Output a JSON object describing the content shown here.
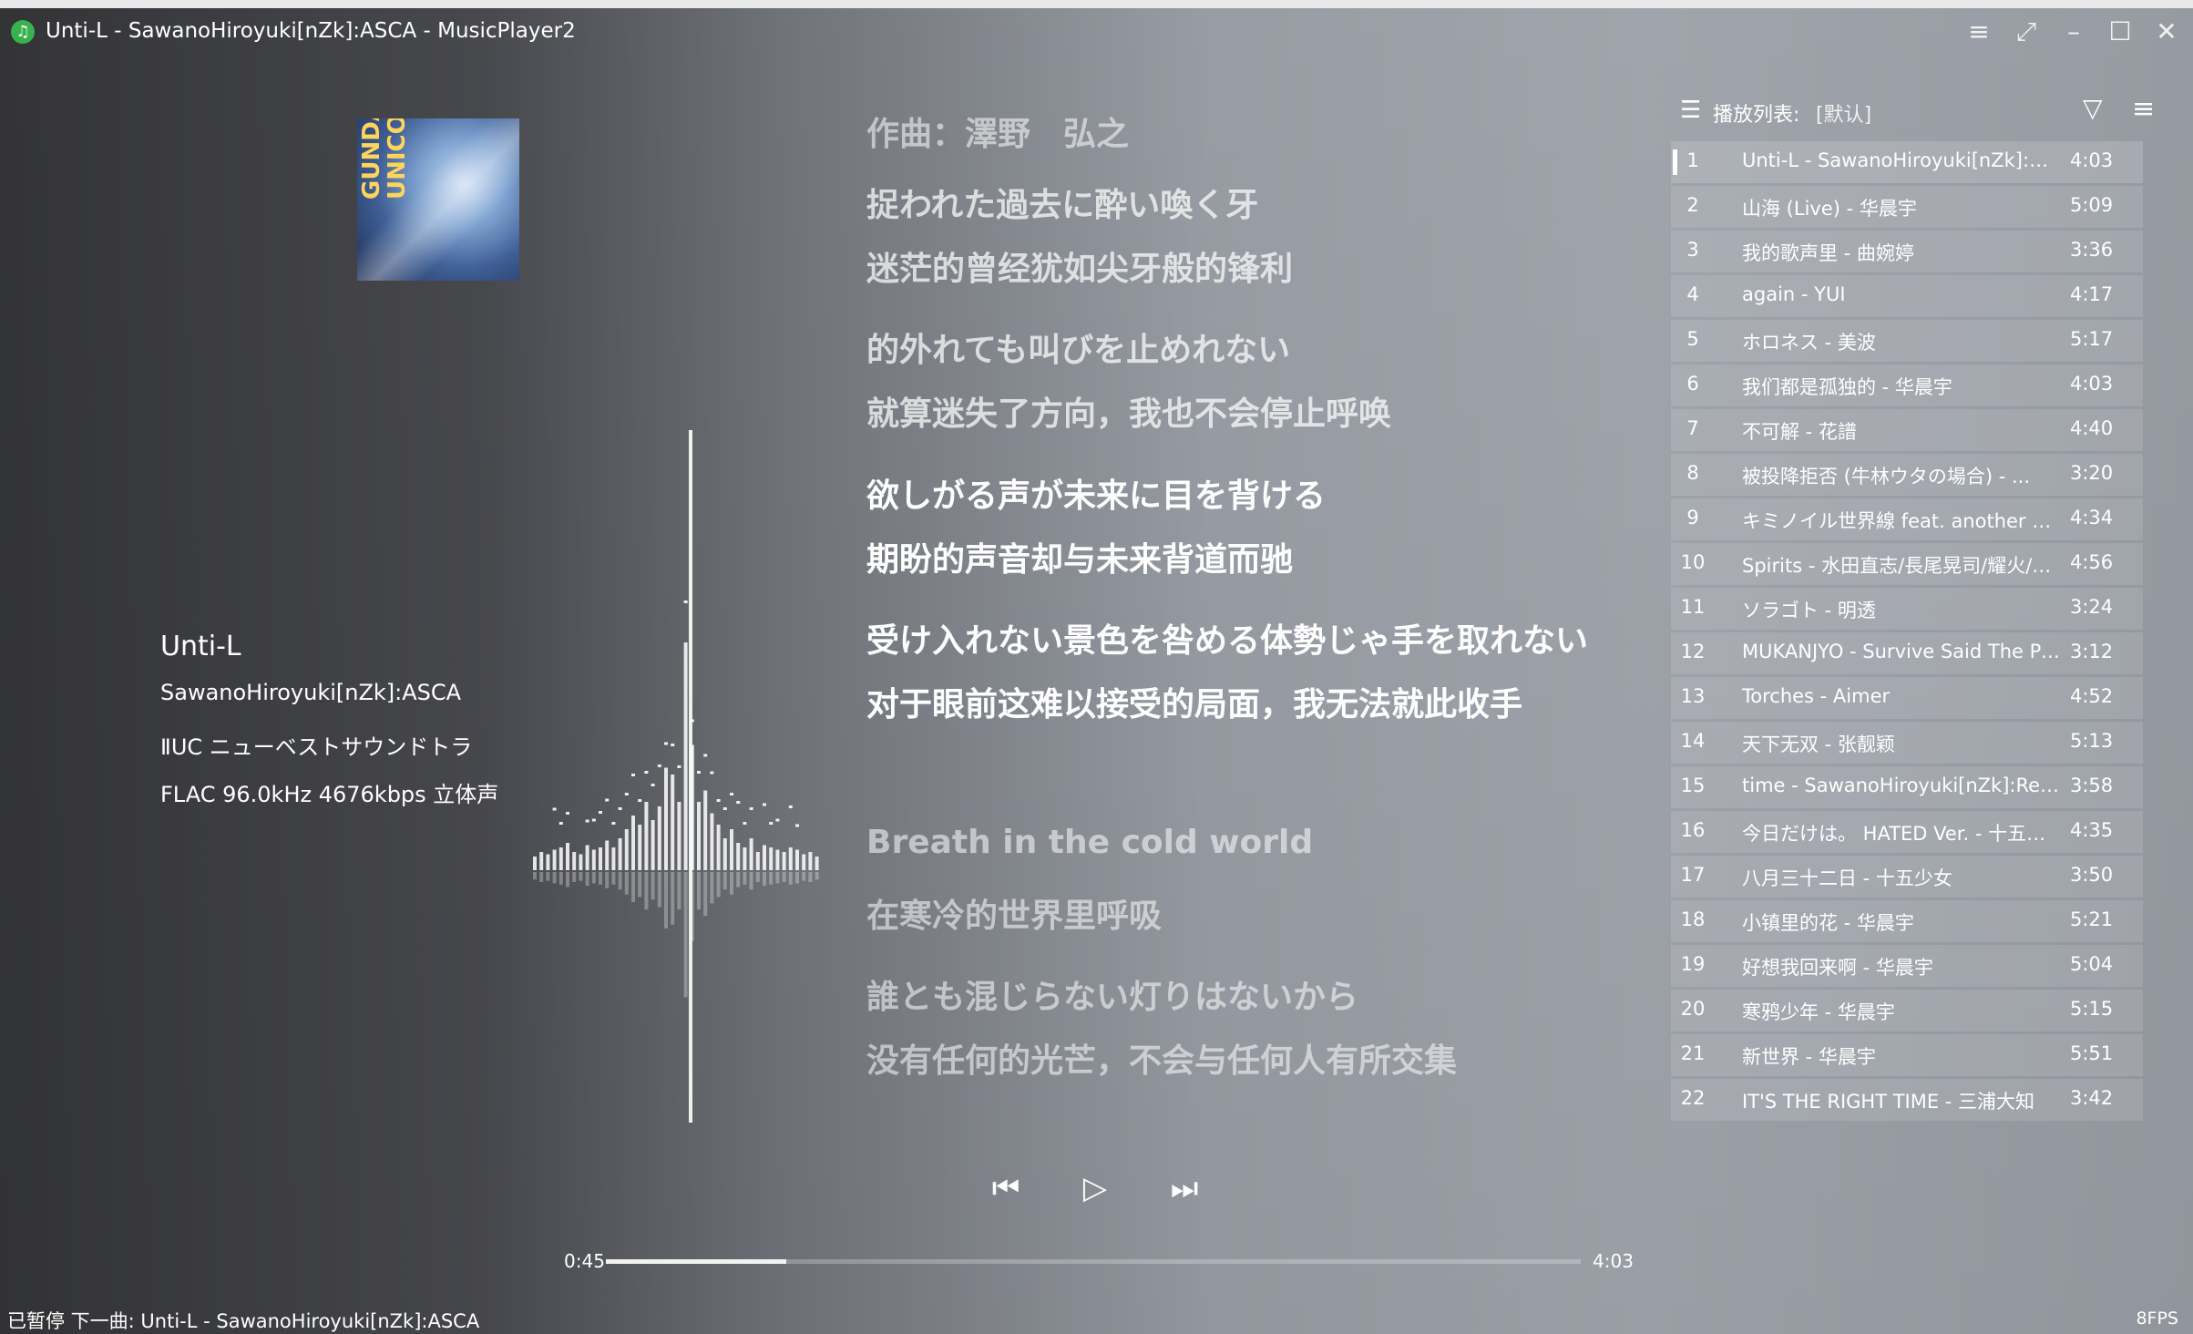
{
  "window": {
    "title": "Unti-L - SawanoHiroyuki[nZk]:ASCA - MusicPlayer2",
    "app_icon": "music-note-icon",
    "buttons": {
      "menu": "≡",
      "mini_mode": "⤢",
      "minimize": "–",
      "maximize": "☐",
      "close": "✕"
    }
  },
  "cover": {
    "text_line1": "GUNDAM",
    "text_line2": "UNICORN"
  },
  "song_info": {
    "title": "Unti-L",
    "artist": "SawanoHiroyuki[nZk]:ASCA",
    "album": "ⅡUC ニューベストサウンドトラック",
    "format": "FLAC 96.0kHz 4676kbps 立体声"
  },
  "lyrics": [
    {
      "text": "作曲：澤野　弘之"
    },
    {
      "text": "捉われた過去に酔い喚く牙"
    },
    {
      "text": "迷茫的曾经犹如尖牙般的锋利"
    },
    {
      "text": "的外れても叫びを止めれない"
    },
    {
      "text": "就算迷失了方向，我也不会停止呼唤"
    },
    {
      "text": "欲しがる声が未来に目を背ける"
    },
    {
      "text": "期盼的声音却与未来背道而驰"
    },
    {
      "text": "受け入れない景色を咎める体勢じゃ手を取れない"
    },
    {
      "text": "对于眼前这难以接受的局面，我无法就此收手"
    },
    {
      "text": "Breath in the cold world"
    },
    {
      "text": "在寒冷的世界里呼吸"
    },
    {
      "text": "誰とも混じらない灯りはないから"
    },
    {
      "text": "没有任何的光芒，不会与任何人有所交集"
    }
  ],
  "controls": {
    "prev": "⏮",
    "play": "▷",
    "next": "⏭"
  },
  "progress": {
    "current_time": "0:45",
    "total_time": "4:03",
    "fraction": 0.1852
  },
  "playlist": {
    "label": "播放列表:",
    "name": "[默认]",
    "current_index": 0,
    "items": [
      {
        "num": "1",
        "name": "Unti-L - SawanoHiroyuki[nZk]:AS...",
        "dur": "4:03"
      },
      {
        "num": "2",
        "name": "山海 (Live) - 华晨宇",
        "dur": "5:09"
      },
      {
        "num": "3",
        "name": "我的歌声里 - 曲婉婷",
        "dur": "3:36"
      },
      {
        "num": "4",
        "name": "again - YUI",
        "dur": "4:17"
      },
      {
        "num": "5",
        "name": "ホロネス - 美波",
        "dur": "5:17"
      },
      {
        "num": "6",
        "name": "我们都是孤独的 - 华晨宇",
        "dur": "4:03"
      },
      {
        "num": "7",
        "name": "不可解 - 花譜",
        "dur": "4:40"
      },
      {
        "num": "8",
        "name": "被投降拒否 (牛林ウタの場合) - ...",
        "dur": "3:20"
      },
      {
        "num": "9",
        "name": "キミノイル世界線 feat. another an...",
        "dur": "4:34"
      },
      {
        "num": "10",
        "name": "Spirits - 水田直志/長尾晃司/耀火/K...",
        "dur": "4:56"
      },
      {
        "num": "11",
        "name": "ソラゴト - 明透",
        "dur": "3:24"
      },
      {
        "num": "12",
        "name": "MUKANJYO - Survive Said The Pr...",
        "dur": "3:12"
      },
      {
        "num": "13",
        "name": "Torches - Aimer",
        "dur": "4:52"
      },
      {
        "num": "14",
        "name": "天下无双 - 张靓颖",
        "dur": "5:13"
      },
      {
        "num": "15",
        "name": "time - SawanoHiroyuki[nZk]:Reo...",
        "dur": "3:58"
      },
      {
        "num": "16",
        "name": "今日だけは。 HATED Ver. - 十五少女",
        "dur": "4:35"
      },
      {
        "num": "17",
        "name": "八月三十二日 - 十五少女",
        "dur": "3:50"
      },
      {
        "num": "18",
        "name": "小镇里的花 - 华晨宇",
        "dur": "5:21"
      },
      {
        "num": "19",
        "name": "好想我回来啊 - 华晨宇",
        "dur": "5:04"
      },
      {
        "num": "20",
        "name": "寒鸦少年 - 华晨宇",
        "dur": "5:15"
      },
      {
        "num": "21",
        "name": "新世界 - 华晨宇",
        "dur": "5:51"
      },
      {
        "num": "22",
        "name": "IT'S THE RIGHT TIME - 三浦大知",
        "dur": "3:42"
      }
    ]
  },
  "status": {
    "text": "已暂停   下一曲: Unti-L - SawanoHiroyuki[nZk]:ASCA",
    "fps": "8FPS"
  },
  "spectrum_levels": [
    0.06,
    0.08,
    0.07,
    0.09,
    0.1,
    0.12,
    0.08,
    0.07,
    0.11,
    0.09,
    0.1,
    0.13,
    0.1,
    0.14,
    0.18,
    0.24,
    0.2,
    0.3,
    0.22,
    0.28,
    0.45,
    0.42,
    0.3,
    1.0,
    0.55,
    0.3,
    0.35,
    0.25,
    0.2,
    0.14,
    0.18,
    0.12,
    0.1,
    0.14,
    0.08,
    0.11,
    0.1,
    0.09,
    0.08,
    0.1,
    0.09,
    0.07,
    0.08,
    0.06
  ]
}
